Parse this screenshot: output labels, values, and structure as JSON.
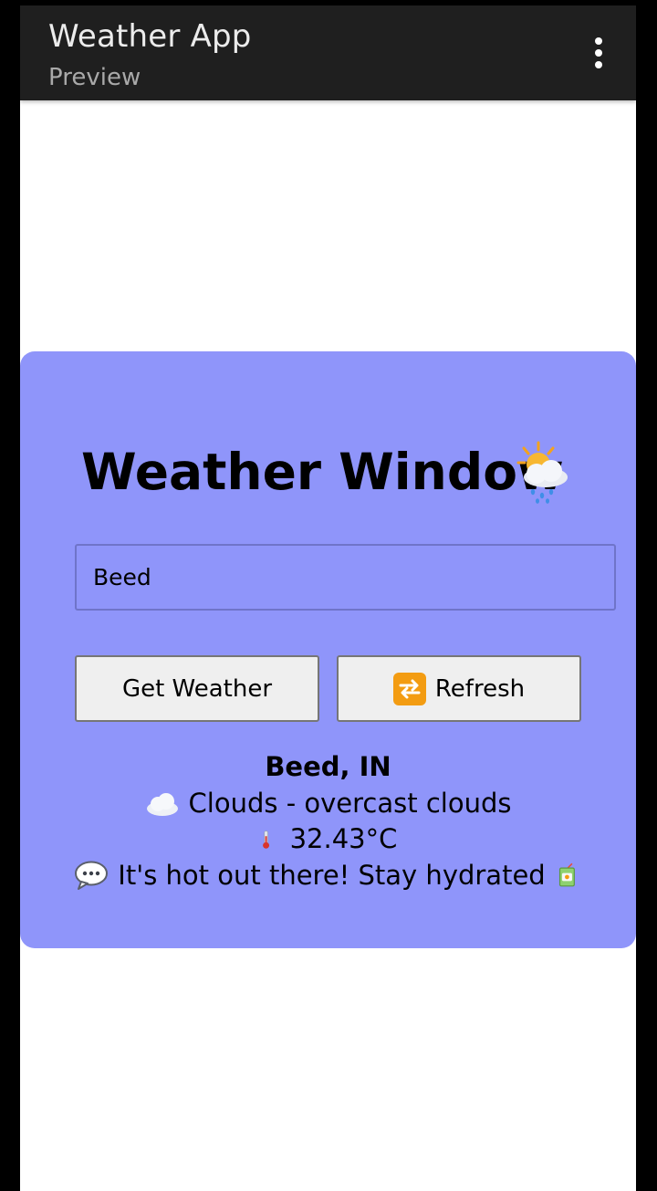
{
  "appbar": {
    "title": "Weather App",
    "subtitle": "Preview",
    "menu_icon": "more-vert-icon"
  },
  "card": {
    "title": "Weather Window",
    "title_icon": "sun-cloud-rain-icon",
    "background": "#8f95fa",
    "input": {
      "value": "Beed",
      "placeholder": ""
    },
    "buttons": {
      "get_weather": "Get Weather",
      "refresh": "Refresh",
      "refresh_icon": "repeat-icon"
    },
    "result": {
      "location": "Beed, IN",
      "condition": "Clouds - overcast clouds",
      "condition_icon": "cloud-icon",
      "temperature": "32.43°C",
      "temperature_icon": "thermometer-icon",
      "message": "It's hot out there! Stay hydrated",
      "message_icon": "speech-bubble-icon",
      "message_end_icon": "juice-box-icon"
    }
  }
}
